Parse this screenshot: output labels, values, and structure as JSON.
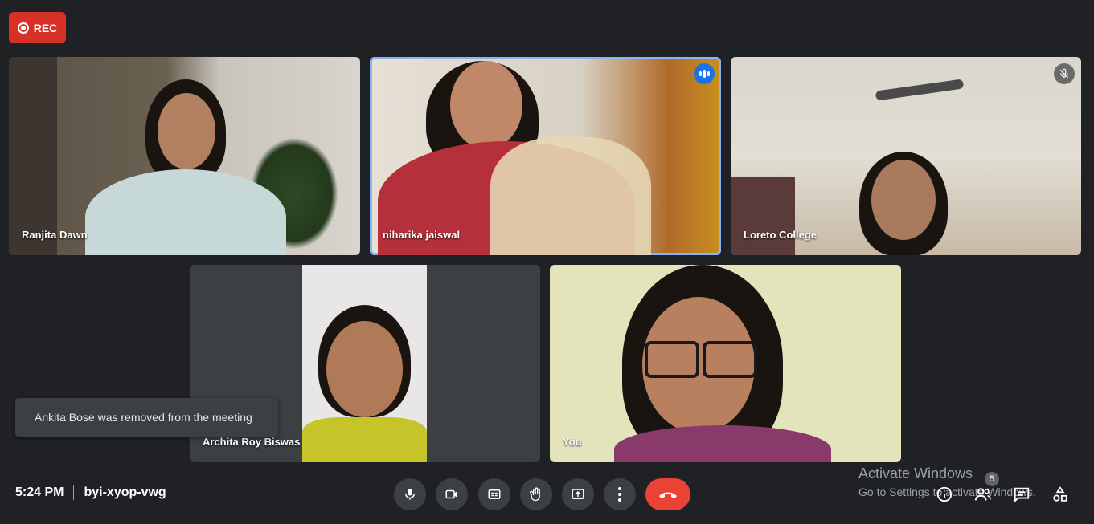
{
  "recording": {
    "label": "REC"
  },
  "participants": [
    {
      "name": "Ranjita Dawn"
    },
    {
      "name": "niharika jaiswal"
    },
    {
      "name": "Loreto College"
    },
    {
      "name": "Archita Roy Biswas"
    },
    {
      "name": "You"
    }
  ],
  "toast": {
    "message": "Ankita Bose was removed from the meeting"
  },
  "meeting": {
    "time": "5:24 PM",
    "code": "byi-xyop-vwg"
  },
  "participant_count": "5",
  "watermark": {
    "title": "Activate Windows",
    "subtitle": "Go to Settings to activate Windows."
  },
  "colors": {
    "accent": "#8ab4f8",
    "end_call": "#ea4335",
    "rec": "#d93025",
    "background": "#202124"
  },
  "icons": [
    "record-icon",
    "speaking-icon",
    "mic-off-icon",
    "mic-icon",
    "camera-icon",
    "captions-icon",
    "raise-hand-icon",
    "present-icon",
    "more-options-icon",
    "end-call-icon",
    "info-icon",
    "people-icon",
    "chat-icon",
    "activities-icon"
  ]
}
